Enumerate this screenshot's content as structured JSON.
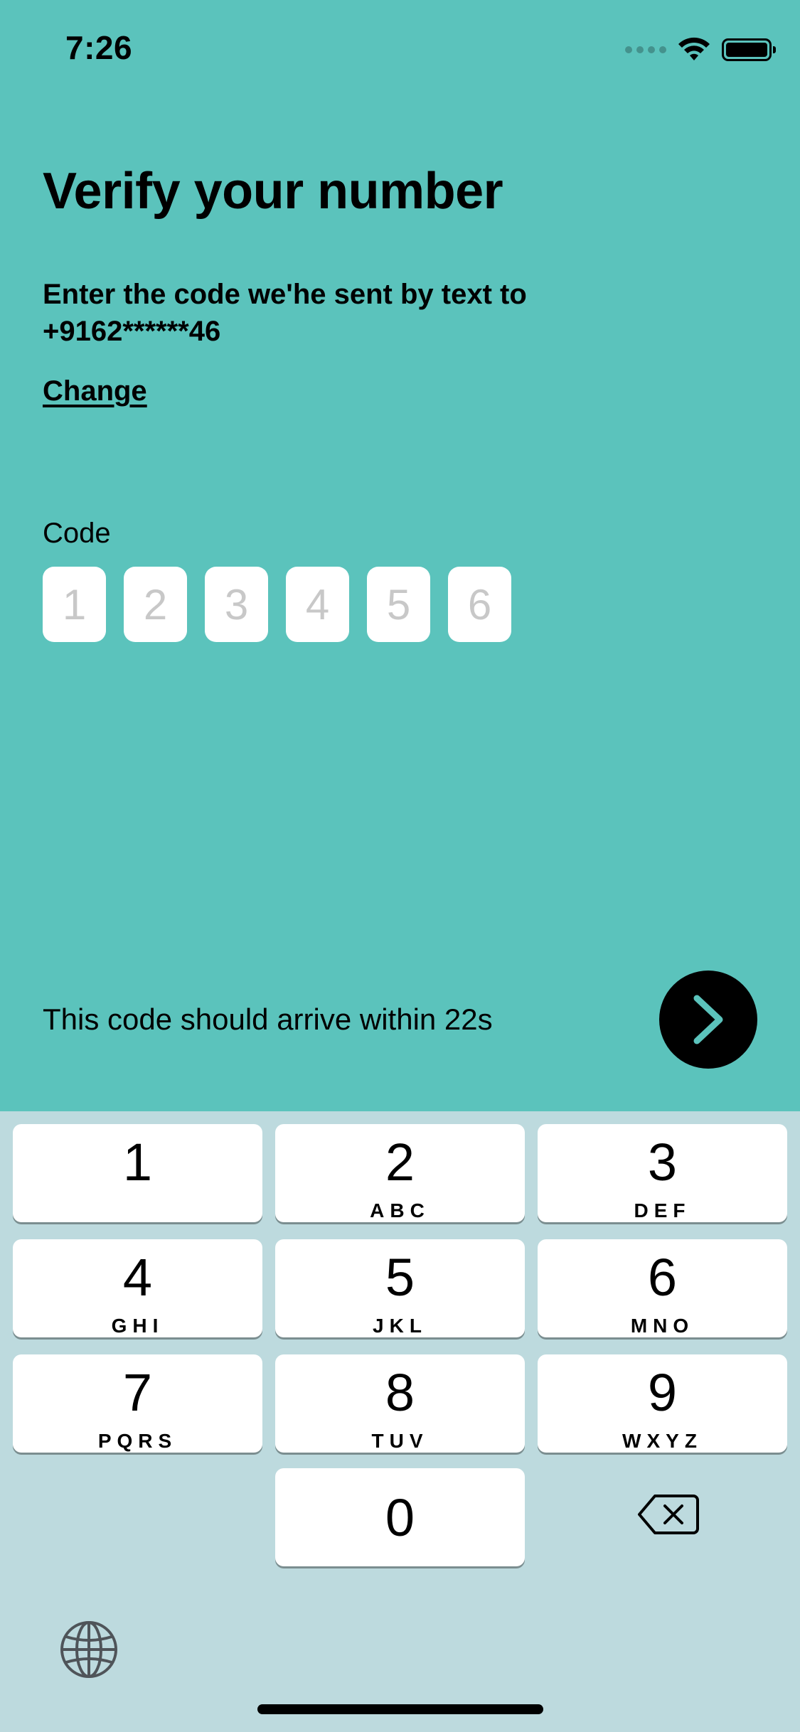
{
  "status_bar": {
    "time": "7:26"
  },
  "verify": {
    "title": "Verify your number",
    "subtitle_line1": "Enter the code we'he sent by text to",
    "subtitle_line2": "+9162******46",
    "change_label": "Change",
    "code_label": "Code",
    "code_placeholders": [
      "1",
      "2",
      "3",
      "4",
      "5",
      "6"
    ],
    "arrive_text": "This code should arrive within 22s",
    "next_icon": "chevron-right-icon"
  },
  "keyboard": {
    "keys": [
      {
        "digit": "1",
        "letters": ""
      },
      {
        "digit": "2",
        "letters": "ABC"
      },
      {
        "digit": "3",
        "letters": "DEF"
      },
      {
        "digit": "4",
        "letters": "GHI"
      },
      {
        "digit": "5",
        "letters": "JKL"
      },
      {
        "digit": "6",
        "letters": "MNO"
      },
      {
        "digit": "7",
        "letters": "PQRS"
      },
      {
        "digit": "8",
        "letters": "TUV"
      },
      {
        "digit": "9",
        "letters": "WXYZ"
      },
      {
        "digit": "0",
        "letters": ""
      }
    ],
    "delete_icon": "backspace-icon",
    "globe_icon": "globe-icon"
  },
  "colors": {
    "background": "#5BC3BC",
    "keyboard_bg": "#BDDADE",
    "button_bg": "#000000",
    "chevron": "#5BC3BC"
  }
}
